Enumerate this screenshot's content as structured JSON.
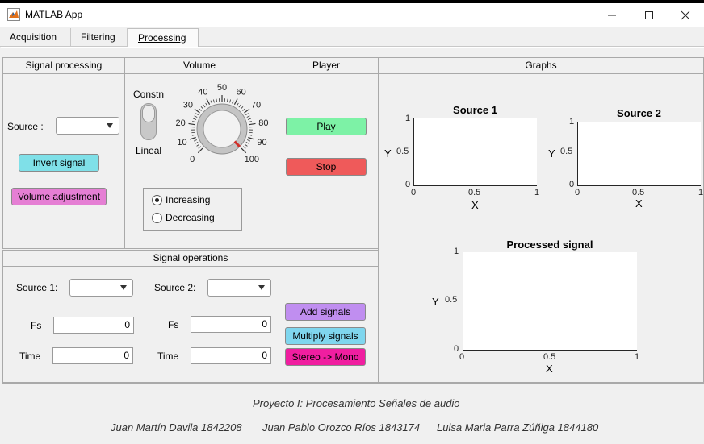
{
  "window": {
    "title": "MATLAB App"
  },
  "tabs": [
    {
      "label": "Acquisition"
    },
    {
      "label": "Filtering"
    },
    {
      "label": "Processing"
    }
  ],
  "signal_processing": {
    "title": "Signal processing",
    "source_label": "Source :",
    "source_value": "",
    "invert_label": "Invert signal",
    "volume_adj_label": "Volume adjustment",
    "colors": {
      "invert": "#7fe0e8",
      "volume": "#e57fd4"
    }
  },
  "volume": {
    "title": "Volume",
    "switch_top": "Constn",
    "switch_bottom": "Lineal",
    "knob_ticks": [
      "0",
      "10",
      "20",
      "30",
      "40",
      "50",
      "60",
      "70",
      "80",
      "90",
      "100"
    ],
    "knob_value": 100,
    "radio_increasing": "Increasing",
    "radio_decreasing": "Decreasing",
    "radio_selected": "Increasing"
  },
  "player": {
    "title": "Player",
    "play_label": "Play",
    "stop_label": "Stop",
    "colors": {
      "play": "#7df2a6",
      "stop": "#ef5a5a"
    }
  },
  "graphs": {
    "title": "Graphs",
    "axes": [
      {
        "title": "Source 1",
        "xlabel": "X",
        "ylabel": "Y",
        "xticks": [
          "0",
          "0.5",
          "1"
        ],
        "yticks": [
          "0",
          "0.5",
          "1"
        ]
      },
      {
        "title": "Source 2",
        "xlabel": "X",
        "ylabel": "Y",
        "xticks": [
          "0",
          "0.5",
          "1"
        ],
        "yticks": [
          "0",
          "0.5",
          "1"
        ]
      },
      {
        "title": "Processed signal",
        "xlabel": "X",
        "ylabel": "Y",
        "xticks": [
          "0",
          "0.5",
          "1"
        ],
        "yticks": [
          "0",
          "0.5",
          "1"
        ]
      }
    ]
  },
  "signal_operations": {
    "title": "Signal operations",
    "source1_label": "Source 1:",
    "source2_label": "Source 2:",
    "fs_label": "Fs",
    "time_label": "Time",
    "fs1_value": "0",
    "fs2_value": "0",
    "time1_value": "0",
    "time2_value": "0",
    "add_label": "Add signals",
    "multiply_label": "Multiply signals",
    "stereo_label": "Stereo -> Mono",
    "colors": {
      "add": "#c08ef0",
      "multiply": "#7fd6ee",
      "stereo": "#f01ea0"
    }
  },
  "footer": {
    "project": "Proyecto I: Procesamiento Señales de audio",
    "author1": "Juan Martín Davila  1842208",
    "author2": "Juan Pablo Orozco Ríos  1843174",
    "author3": "Luisa Maria Parra Zúñiga  1844180"
  }
}
